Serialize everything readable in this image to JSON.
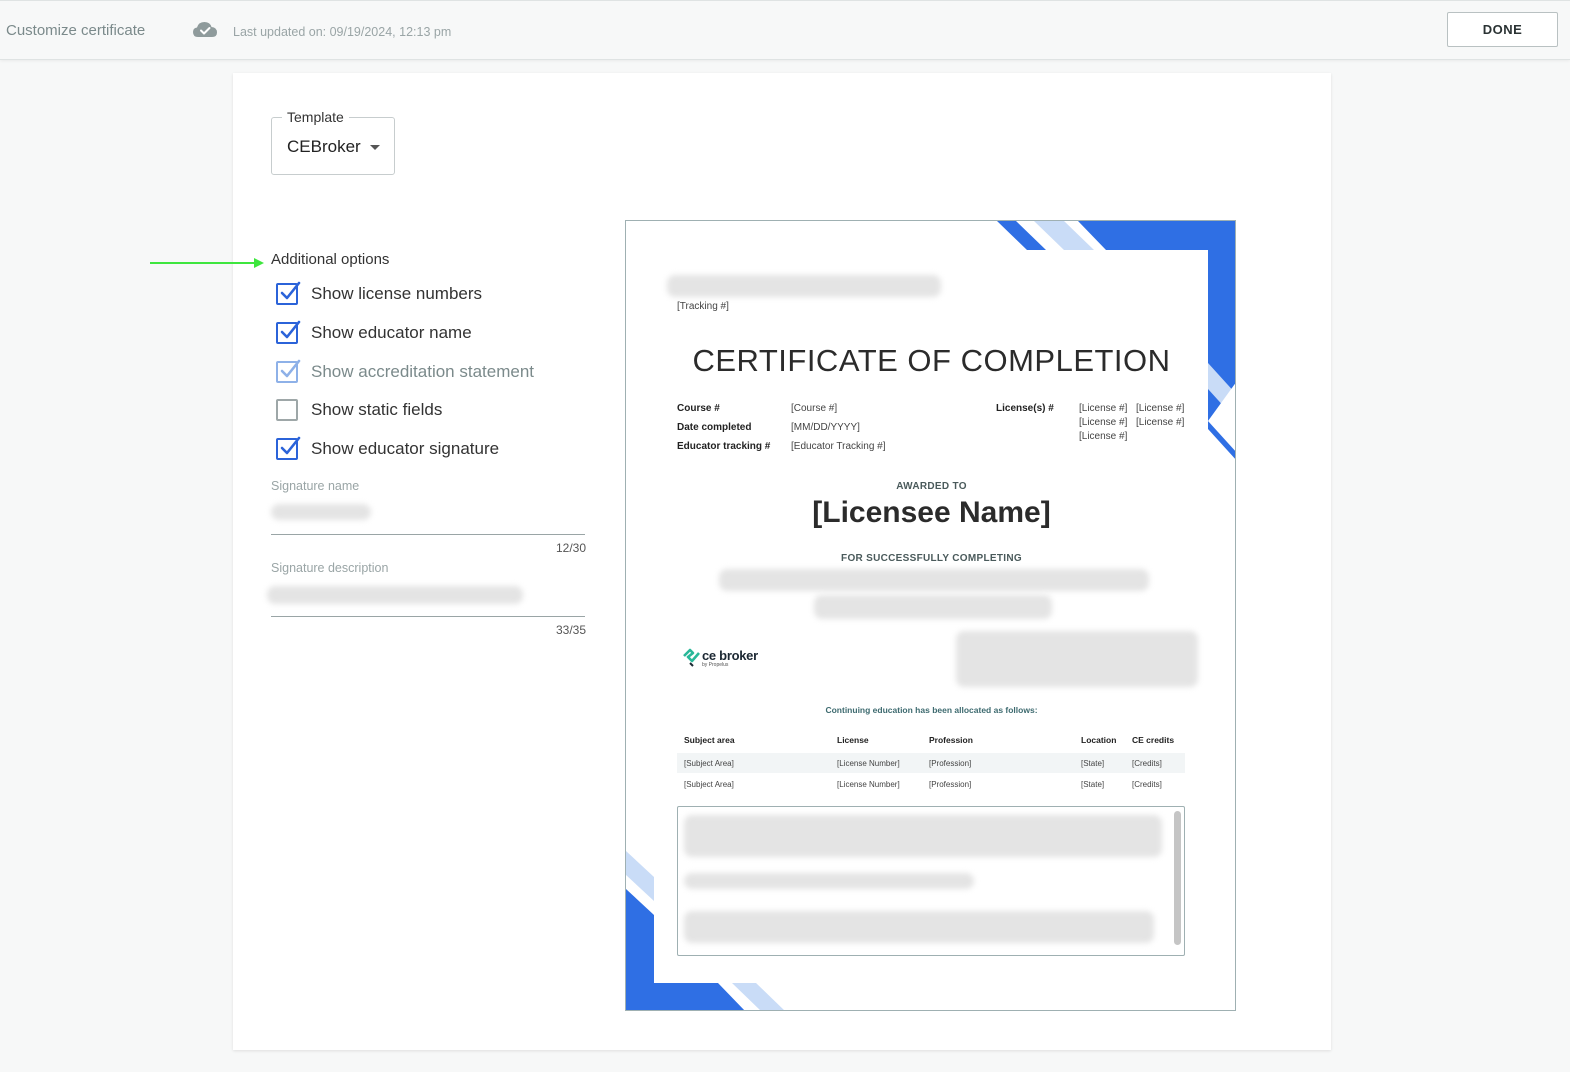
{
  "topbar": {
    "title": "Customize certificate",
    "last_updated": "Last updated on: 09/19/2024, 12:13 pm",
    "done_label": "DONE",
    "cloud_icon": "cloud-check-icon"
  },
  "template": {
    "label": "Template",
    "value": "CEBroker"
  },
  "options": {
    "title": "Additional options",
    "items": [
      {
        "label": "Show license numbers",
        "checked": true,
        "disabled": false
      },
      {
        "label": "Show educator name",
        "checked": true,
        "disabled": false
      },
      {
        "label": "Show accreditation statement",
        "checked": true,
        "disabled": true
      },
      {
        "label": "Show static fields",
        "checked": false,
        "disabled": false
      },
      {
        "label": "Show educator signature",
        "checked": true,
        "disabled": false
      }
    ]
  },
  "signature": {
    "name_label": "Signature name",
    "name_counter": "12/30",
    "description_label": "Signature description",
    "description_counter": "33/35"
  },
  "certificate": {
    "tracking": "[Tracking #]",
    "title": "CERTIFICATE OF COMPLETION",
    "course_key": "Course #",
    "course_val": "[Course #]",
    "date_key": "Date completed",
    "date_val": "[MM/DD/YYYY]",
    "educator_key": "Educator tracking #",
    "educator_val": "[Educator Tracking #]",
    "license_key": "License(s) #",
    "license_vals": [
      "[License #]",
      "[License #]",
      "[License #]",
      "[License #]",
      "[License #]"
    ],
    "awarded_to": "AWARDED TO",
    "licensee": "[Licensee Name]",
    "for_completing": "FOR SUCCESSFULLY COMPLETING",
    "logo_text": "ce broker",
    "logo_sub": "by Propelus",
    "allocation_note": "Continuing education has been allocated as follows:",
    "table": {
      "headers": [
        "Subject area",
        "License",
        "Profession",
        "Location",
        "CE credits"
      ],
      "rows": [
        [
          "[Subject Area]",
          "[License Number]",
          "[Profession]",
          "[State]",
          "[Credits]"
        ],
        [
          "[Subject Area]",
          "[License Number]",
          "[Profession]",
          "[State]",
          "[Credits]"
        ]
      ]
    },
    "accent_color": "#2f6fe4",
    "accent_light": "#c9dcf7"
  }
}
